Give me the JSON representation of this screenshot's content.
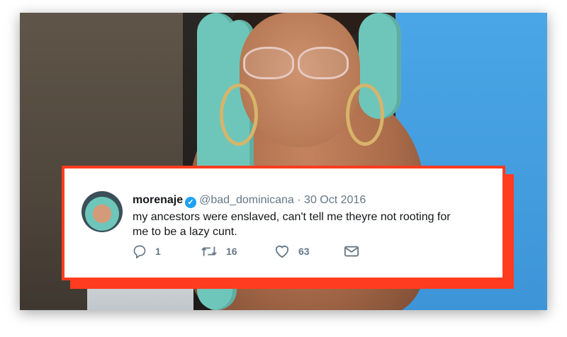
{
  "tweet": {
    "display_name": "morenaje",
    "handle": "@bad_dominicana",
    "separator": "·",
    "date": "30 Oct 2016",
    "text": "my ancestors were enslaved, can't tell me theyre not rooting for me to be a lazy cunt.",
    "verified": true,
    "actions": {
      "reply_count": "1",
      "retweet_count": "16",
      "like_count": "63"
    }
  },
  "colors": {
    "accent_border": "#ff3c1f",
    "verified_badge": "#1da1f2",
    "icon_gray": "#657786",
    "hair_teal": "#6ec6ba"
  },
  "icons": {
    "verified": "verified-badge-icon",
    "reply": "reply-icon",
    "retweet": "retweet-icon",
    "like": "heart-icon",
    "message": "envelope-icon"
  }
}
